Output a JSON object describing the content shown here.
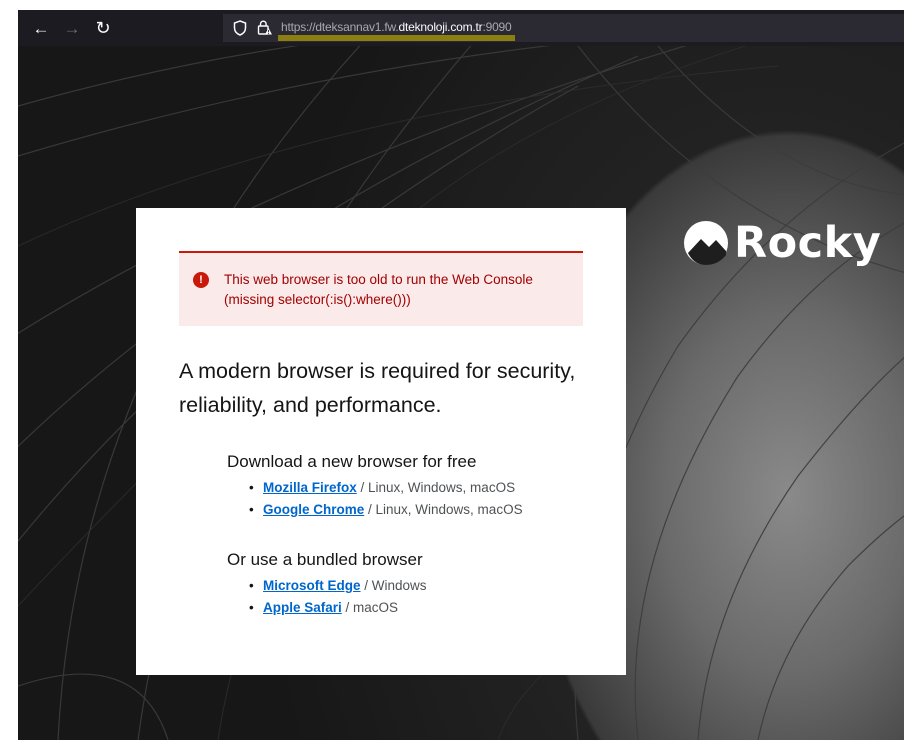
{
  "browser": {
    "url_scheme": "https://",
    "url_subdomain": "dteksannav1.fw.",
    "url_domain": "dteknoloji.com.tr",
    "url_port": ":9090",
    "icons": {
      "back": "arrow-left",
      "forward": "arrow-right",
      "reload": "reload",
      "tracking": "shield",
      "lock": "lock-warning"
    }
  },
  "brand": {
    "logo_text": "Rocky"
  },
  "alert": {
    "message": "This web browser is too old to run the Web Console (missing selector(:is():where()))",
    "icon": "exclamation-circle",
    "color": "#c9190b"
  },
  "lead_text": "A modern browser is required for security, reliability, and performance.",
  "sections": [
    {
      "title": "Download a new browser for free",
      "items": [
        {
          "name": "Mozilla Firefox",
          "platforms": " / Linux, Windows, macOS"
        },
        {
          "name": "Google Chrome",
          "platforms": " / Linux, Windows, macOS"
        }
      ]
    },
    {
      "title": "Or use a bundled browser",
      "items": [
        {
          "name": "Microsoft Edge",
          "platforms": " / Windows"
        },
        {
          "name": "Apple Safari",
          "platforms": " / macOS"
        }
      ]
    }
  ],
  "colors": {
    "link": "#0066cc",
    "danger": "#c9190b",
    "alert_bg": "#faeaea"
  }
}
